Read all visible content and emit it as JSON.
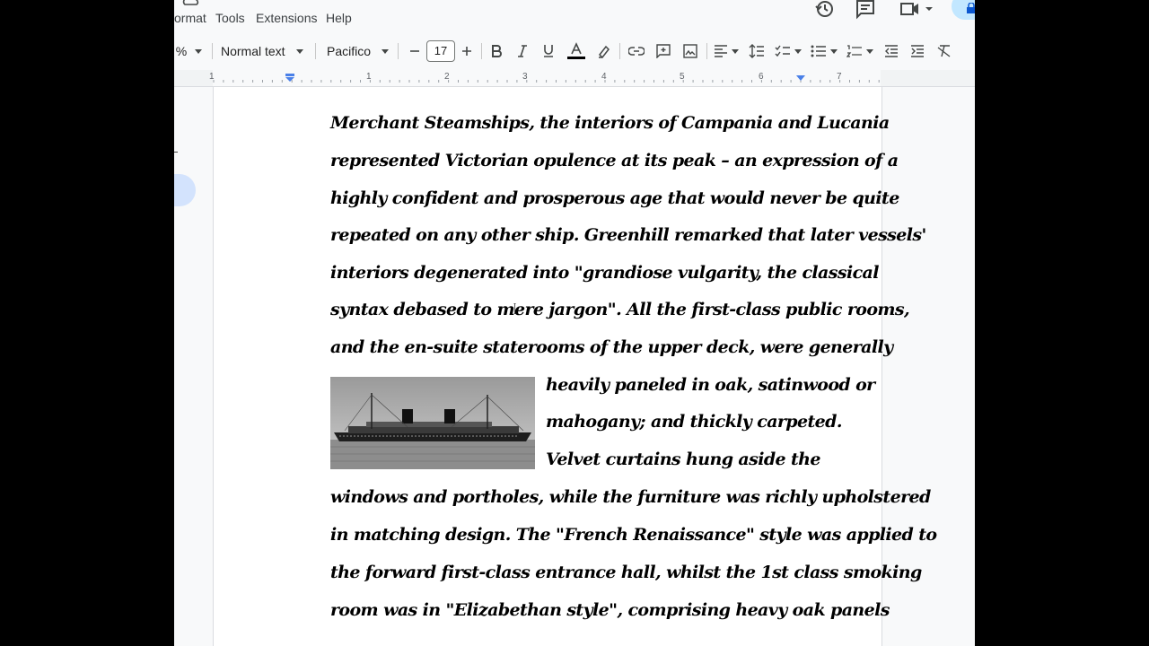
{
  "menubar": {
    "format_label": "ormat",
    "tools_label": "Tools",
    "extensions_label": "Extensions",
    "help_label": "Help",
    "icons": [
      "cloud-status-icon",
      "history-icon",
      "comments-icon",
      "meet-icon",
      "lock-icon"
    ]
  },
  "toolbar": {
    "zoom_value": "%",
    "style_value": "Normal text",
    "font_value": "Pacifico",
    "font_size": "17",
    "icons": [
      "minus-icon",
      "plus-icon",
      "bold-icon",
      "italic-icon",
      "underline-icon",
      "text-color-icon",
      "highlight-icon",
      "link-icon",
      "add-comment-icon",
      "insert-image-icon",
      "align-icon",
      "line-spacing-icon",
      "checklist-icon",
      "bulleted-list-icon",
      "numbered-list-icon",
      "decrease-indent-icon",
      "increase-indent-icon",
      "clear-formatting-icon"
    ],
    "text_color_accent": "#000000"
  },
  "ruler": {
    "numbers": [
      "1",
      "1",
      "2",
      "3",
      "4",
      "5",
      "6",
      "7"
    ]
  },
  "document": {
    "lines": [
      "Merchant Steamships, the interiors of Campania and Lucania",
      "represented Victorian opulence at its peak – an expression of a",
      "highly confident and prosperous age that would never be quite",
      "repeated on any other ship. Greenhill remarked that later vessels'",
      "interiors degenerated into \"grandiose vulgarity, the classical",
      "syntax debased to mere jargon\". All the first-class public rooms,",
      "and the en-suite staterooms of the upper deck, were generally",
      "heavily paneled in oak, satinwood or",
      "mahogany; and thickly carpeted.",
      "Velvet curtains hung aside the",
      "windows and portholes, while the furniture was richly upholstered",
      "in matching design. The \"French Renaissance\" style was applied to",
      "the forward first-class entrance hall, whilst the 1st class smoking",
      "room was in \"Elizabethan style\", comprising heavy oak panels"
    ]
  },
  "colors": {
    "app_background": "#f8f9fa",
    "page_background": "#ffffff",
    "ruler_marker": "#4a80e8",
    "share_button": "#c2e7ff"
  }
}
